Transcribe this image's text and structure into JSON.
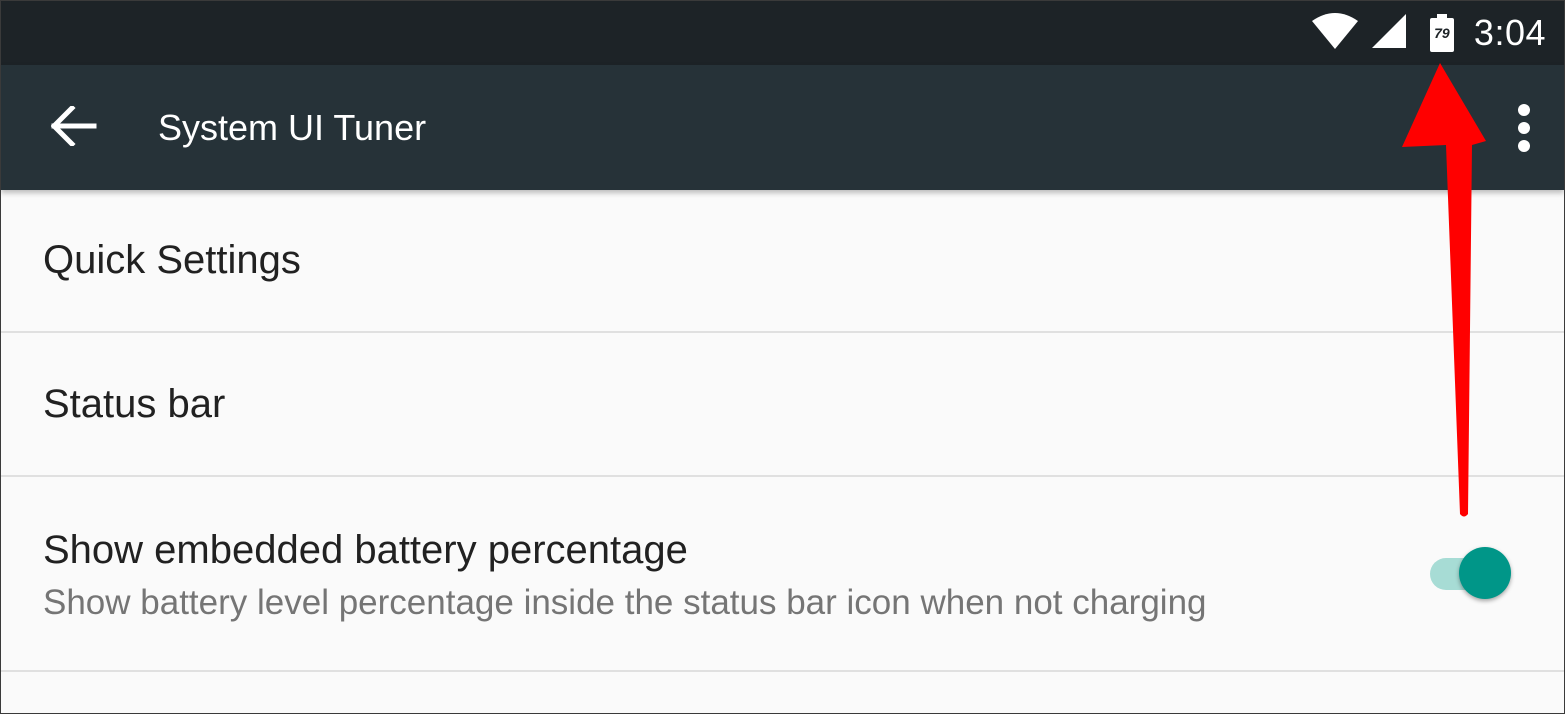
{
  "status_bar": {
    "time": "3:04",
    "battery_percent": "79",
    "icons": [
      "wifi-icon",
      "cell-signal-icon",
      "battery-icon"
    ]
  },
  "app_bar": {
    "title": "System UI Tuner",
    "back_icon": "arrow-back-icon",
    "overflow_icon": "more-vert-icon"
  },
  "list": {
    "items": [
      {
        "title": "Quick Settings"
      },
      {
        "title": "Status bar"
      },
      {
        "title": "Show embedded battery percentage",
        "summary": "Show battery level percentage inside the status bar icon when not charging",
        "switch_on": true
      }
    ]
  },
  "colors": {
    "status_bar": "#1d2327",
    "app_bar": "#263238",
    "accent": "#009688",
    "annotation": "#ff0000"
  }
}
